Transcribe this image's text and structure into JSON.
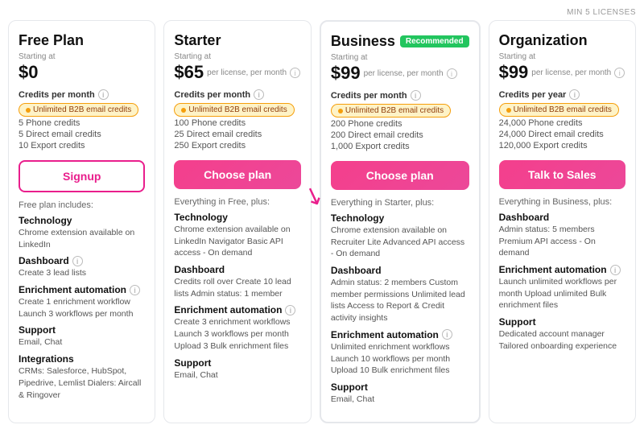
{
  "topNote": "MIN 5 LICENSES",
  "plans": [
    {
      "id": "free",
      "title": "Free Plan",
      "startingAtLabel": "Starting at",
      "price": "$0",
      "priceSuffix": "",
      "recommended": false,
      "creditsLabel": "Credits per month",
      "creditBadge": "Unlimited B2B email credits",
      "creditItems": [
        "5 Phone credits",
        "5 Direct email credits",
        "10 Export credits"
      ],
      "ctaLabel": "Signup",
      "ctaType": "signup",
      "includesLabel": "Free plan includes:",
      "features": [
        {
          "title": "Technology",
          "desc": "Chrome extension available on LinkedIn"
        },
        {
          "title": "Dashboard",
          "desc": "Create 3 lead lists",
          "hasInfo": true
        },
        {
          "title": "Enrichment automation",
          "desc": "Create 1 enrichment workflow\nLaunch 3 workflows per month",
          "hasInfo": true
        },
        {
          "title": "Support",
          "desc": "Email, Chat"
        },
        {
          "title": "Integrations",
          "desc": "CRMs: Salesforce, HubSpot, Pipedrive, Lemlist\nDialers: Aircall & Ringover"
        }
      ]
    },
    {
      "id": "starter",
      "title": "Starter",
      "startingAtLabel": "Starting at",
      "price": "$65",
      "priceSuffix": "per license, per month",
      "recommended": false,
      "creditsLabel": "Credits per month",
      "creditBadge": "Unlimited B2B email credits",
      "creditItems": [
        "100 Phone credits",
        "25 Direct email credits",
        "250 Export credits"
      ],
      "ctaLabel": "Choose plan",
      "ctaType": "choose",
      "includesLabel": "Everything in Free, plus:",
      "features": [
        {
          "title": "Technology",
          "desc": "Chrome extension available on LinkedIn Navigator\nBasic API access - On demand"
        },
        {
          "title": "Dashboard",
          "desc": "Credits roll over\nCreate 10 lead lists\nAdmin status: 1 member"
        },
        {
          "title": "Enrichment automation",
          "desc": "Create 3 enrichment workflows\nLaunch 3 workflows per month\nUpload 3 Bulk enrichment files",
          "hasInfo": true
        },
        {
          "title": "Support",
          "desc": "Email, Chat"
        }
      ]
    },
    {
      "id": "business",
      "title": "Business",
      "startingAtLabel": "Starting at",
      "price": "$99",
      "priceSuffix": "per license, per month",
      "recommended": true,
      "creditsLabel": "Credits per month",
      "creditBadge": "Unlimited B2B email credits",
      "creditItems": [
        "200 Phone credits",
        "200 Direct email credits",
        "1,000 Export credits"
      ],
      "ctaLabel": "Choose plan",
      "ctaType": "choose",
      "includesLabel": "Everything in Starter, plus:",
      "features": [
        {
          "title": "Technology",
          "desc": "Chrome extension available on Recruiter Lite\nAdvanced API access - On demand"
        },
        {
          "title": "Dashboard",
          "desc": "Admin status: 2 members\nCustom member permissions\nUnlimited lead lists\nAccess to Report & Credit activity insights"
        },
        {
          "title": "Enrichment automation",
          "desc": "Unlimited enrichment workflows\nLaunch 10 workflows per month\nUpload 10 Bulk enrichment files",
          "hasInfo": true
        },
        {
          "title": "Support",
          "desc": "Email, Chat"
        }
      ]
    },
    {
      "id": "organization",
      "title": "Organization",
      "startingAtLabel": "Starting at",
      "price": "$99",
      "priceSuffix": "per license, per month",
      "recommended": false,
      "creditsLabel": "Credits per year",
      "creditBadge": "Unlimited B2B email credits",
      "creditItems": [
        "24,000 Phone credits",
        "24,000 Direct email credits",
        "120,000 Export credits"
      ],
      "ctaLabel": "Talk to Sales",
      "ctaType": "talk",
      "includesLabel": "Everything in Business, plus:",
      "features": [
        {
          "title": "Dashboard",
          "desc": "Admin status: 5 members\nPremium API access - On demand"
        },
        {
          "title": "Enrichment automation",
          "desc": "Launch unlimited workflows per month\nUpload unlimited Bulk enrichment files",
          "hasInfo": true
        },
        {
          "title": "Support",
          "desc": "Dedicated account manager\nTailored onboarding experience"
        }
      ]
    }
  ]
}
